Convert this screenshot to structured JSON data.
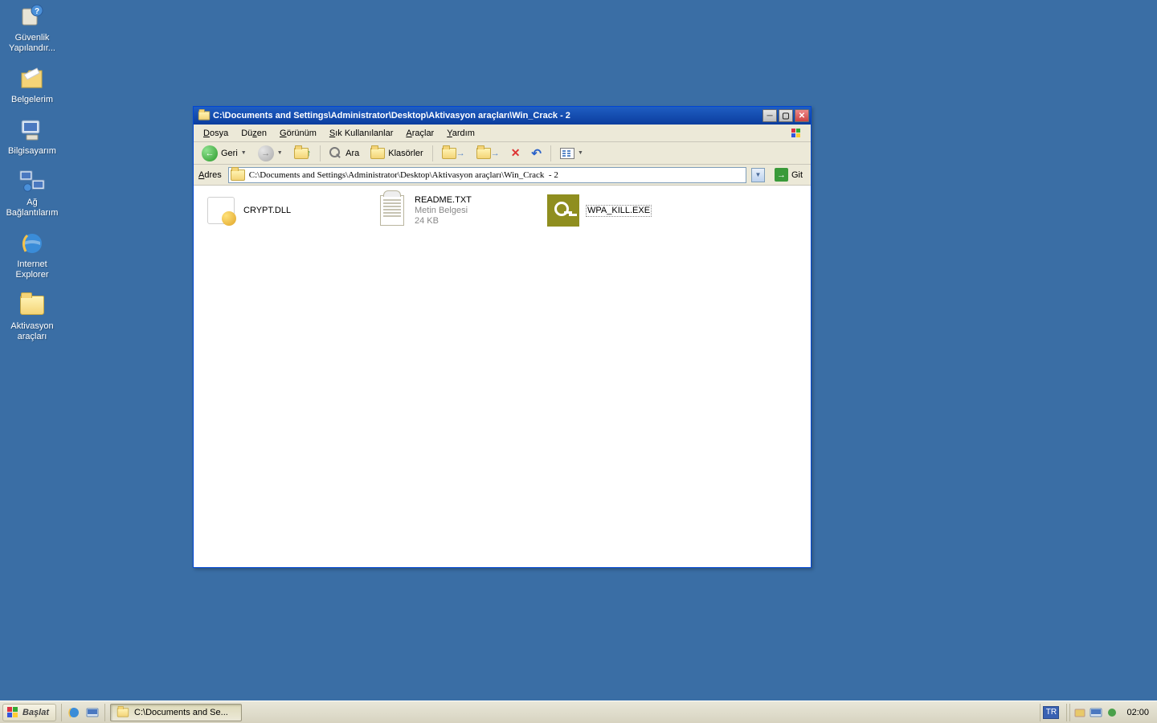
{
  "desktop": {
    "icons": [
      {
        "label": "Güvenlik Yapılandır...",
        "icon": "security-config-icon"
      },
      {
        "label": "Belgelerim",
        "icon": "my-documents-icon"
      },
      {
        "label": "Bilgisayarım",
        "icon": "my-computer-icon"
      },
      {
        "label": "Ağ Bağlantılarım",
        "icon": "network-icon"
      },
      {
        "label": "Internet Explorer",
        "icon": "ie-icon"
      },
      {
        "label": "Aktivasyon araçları",
        "icon": "folder-icon"
      }
    ]
  },
  "window": {
    "title": "C:\\Documents and Settings\\Administrator\\Desktop\\Aktivasyon araçları\\Win_Crack  - 2",
    "menus": [
      "Dosya",
      "Düzen",
      "Görünüm",
      "Sık Kullanılanlar",
      "Araçlar",
      "Yardım"
    ],
    "toolbar": {
      "back": "Geri",
      "search": "Ara",
      "folders": "Klasörler"
    },
    "address": {
      "label": "Adres",
      "value": "C:\\Documents and Settings\\Administrator\\Desktop\\Aktivasyon araçları\\Win_Crack  - 2",
      "go": "Git"
    },
    "files": [
      {
        "name": "CRYPT.DLL",
        "desc1": "",
        "desc2": "",
        "icon": "dll"
      },
      {
        "name": "README.TXT",
        "desc1": "Metin Belgesi",
        "desc2": "24 KB",
        "icon": "txt"
      },
      {
        "name": "WPA_KILL.EXE",
        "desc1": "",
        "desc2": "",
        "icon": "exe",
        "selected": true
      }
    ]
  },
  "taskbar": {
    "start": "Başlat",
    "task": "C:\\Documents and Se...",
    "lang": "TR",
    "clock": "02:00"
  }
}
